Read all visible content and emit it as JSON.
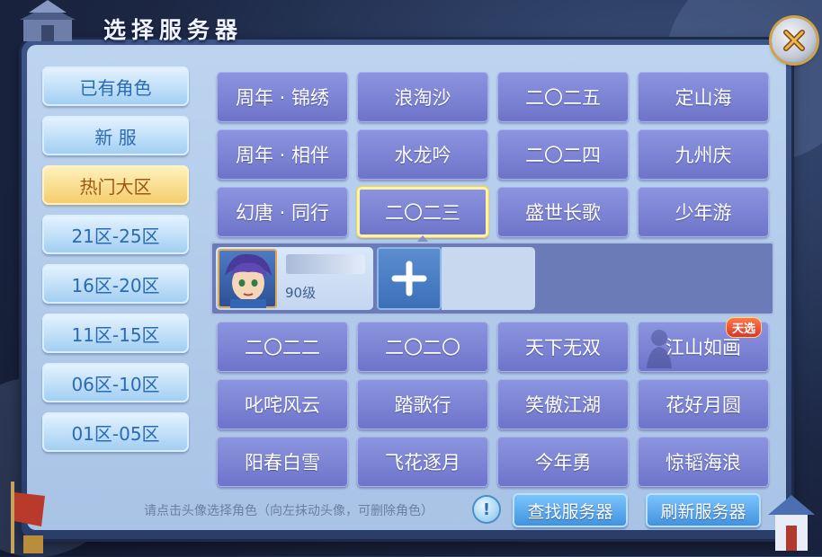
{
  "title": "选择服务器",
  "sidebar": {
    "items": [
      {
        "label": "已有角色",
        "active": false
      },
      {
        "label": "新 服",
        "active": false
      },
      {
        "label": "热门大区",
        "active": true
      },
      {
        "label": "21区-25区",
        "active": false
      },
      {
        "label": "16区-20区",
        "active": false
      },
      {
        "label": "11区-15区",
        "active": false
      },
      {
        "label": "06区-10区",
        "active": false
      },
      {
        "label": "01区-05区",
        "active": false
      }
    ]
  },
  "servers_top": [
    "周年 · 锦绣",
    "浪淘沙",
    "二〇二五",
    "定山海",
    "周年 · 相伴",
    "水龙吟",
    "二〇二四",
    "九州庆",
    "幻唐 · 同行",
    "二〇二三",
    "盛世长歌",
    "少年游"
  ],
  "selected_server": "二〇二三",
  "character": {
    "name": "度",
    "level": "90级"
  },
  "servers_bottom": [
    "二〇二二",
    "二〇二〇",
    "天下无双",
    "江山如画",
    "叱咤风云",
    "踏歌行",
    "笑傲江湖",
    "花好月圆",
    "阳春白雪",
    "飞花逐月",
    "今年勇",
    "惊韬海浪"
  ],
  "special_tag": "天选",
  "hint": "请点击头像选择角色（向左抹动头像，可删除角色）",
  "info_glyph": "!",
  "buttons": {
    "find": "查找服务器",
    "refresh": "刷新服务器"
  },
  "colors": {
    "server_button": "#7b83d6",
    "selected_border": "#f7d251",
    "sidebar_active": "#f4cc69",
    "sidebar_normal": "#9fcdf2",
    "panel": "#b3cbec"
  }
}
